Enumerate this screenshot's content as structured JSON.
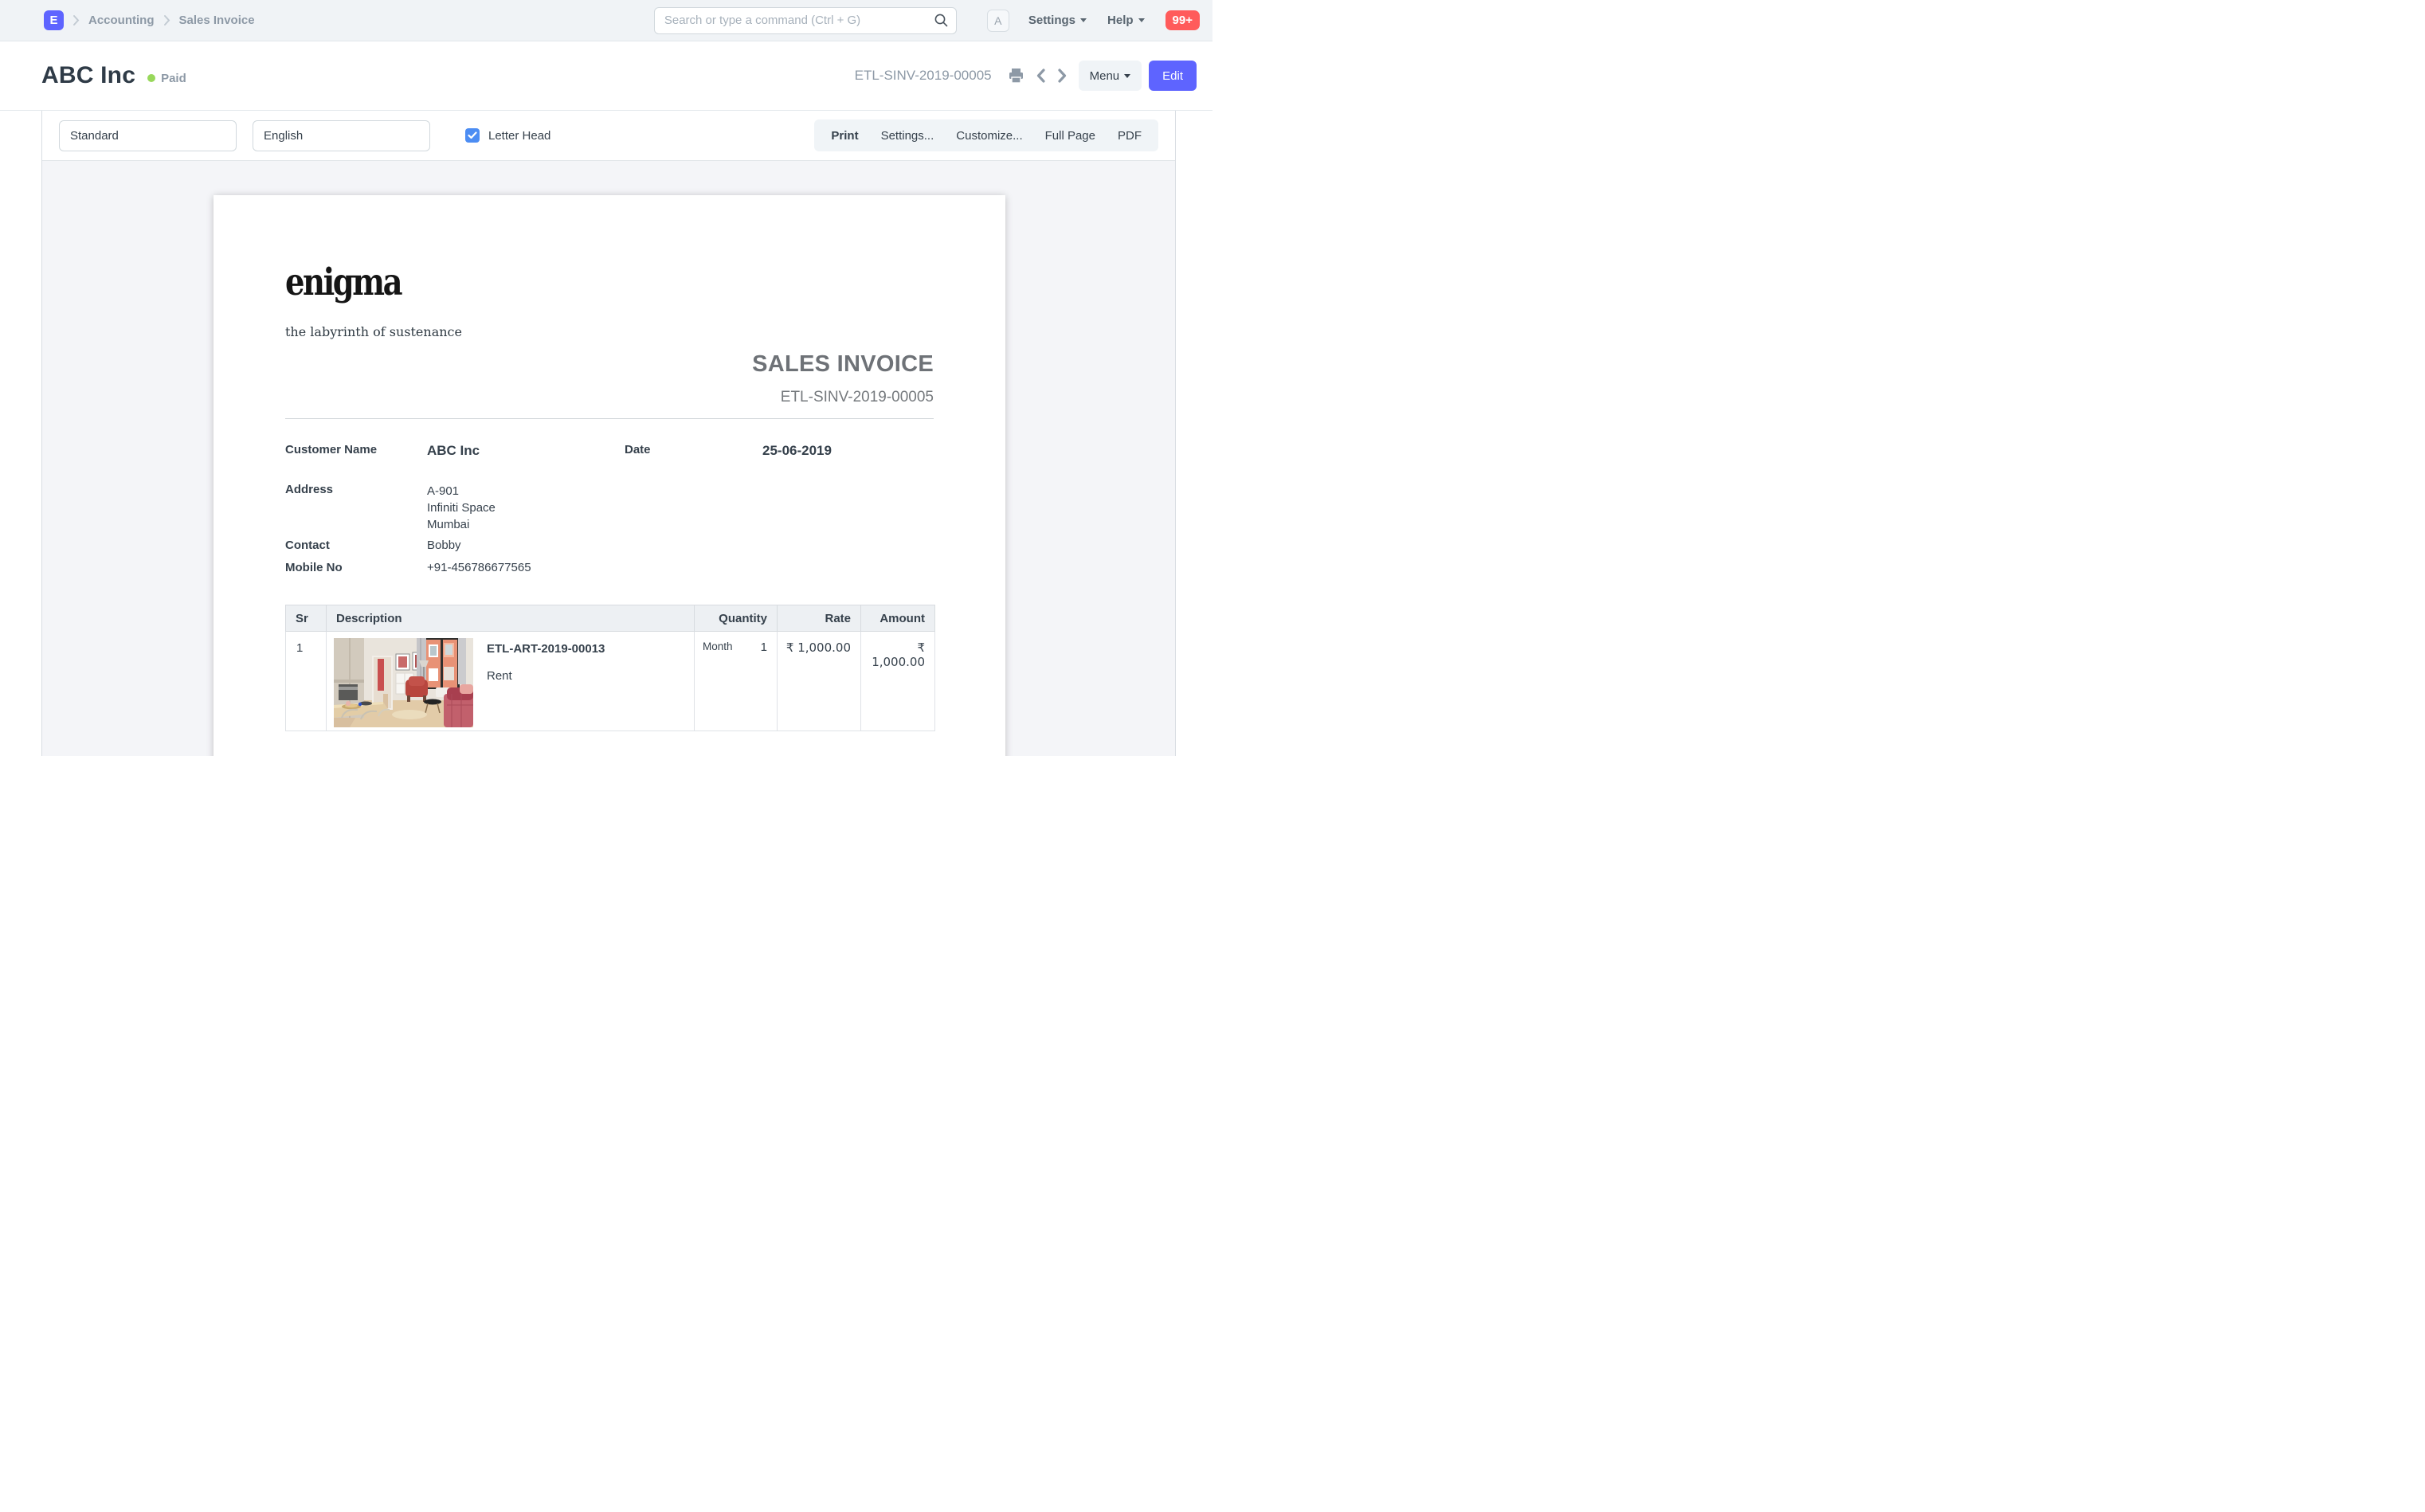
{
  "colors": {
    "accent": "#5e64ff",
    "status_paid": "#98d85b",
    "badge_red": "#ff5b5b",
    "checkbox_blue": "#4c8df3"
  },
  "navbar": {
    "logo_letter": "E",
    "breadcrumbs": [
      "Accounting",
      "Sales Invoice"
    ],
    "search_placeholder": "Search or type a command (Ctrl + G)",
    "avatar_letter": "A",
    "settings_label": "Settings",
    "help_label": "Help",
    "notifications_badge": "99+"
  },
  "page_header": {
    "title": "ABC Inc",
    "status": "Paid",
    "doc_id": "ETL-SINV-2019-00005",
    "menu_label": "Menu",
    "edit_label": "Edit"
  },
  "print_toolbar": {
    "format_select": "Standard",
    "language_select": "English",
    "letterhead_label": "Letter Head",
    "letterhead_checked": true,
    "actions": [
      "Print",
      "Settings...",
      "Customize...",
      "Full Page",
      "PDF"
    ]
  },
  "invoice": {
    "logo_text": "enigma",
    "logo_tagline": "the labyrinth of sustenance",
    "title": "SALES INVOICE",
    "number": "ETL-SINV-2019-00005",
    "details": {
      "customer_name_label": "Customer Name",
      "customer_name": "ABC Inc",
      "date_label": "Date",
      "date": "25-06-2019",
      "address_label": "Address",
      "address_lines": [
        "A-901",
        "Infiniti Space",
        "Mumbai"
      ],
      "contact_label": "Contact",
      "contact": "Bobby",
      "mobile_label": "Mobile No",
      "mobile": "+91-456786677565"
    },
    "items_table": {
      "headers": [
        "Sr",
        "Description",
        "Quantity",
        "Rate",
        "Amount"
      ],
      "rows": [
        {
          "sr": "1",
          "item_code": "ETL-ART-2019-00013",
          "item_name": "Rent",
          "uom": "Month",
          "qty": "1",
          "rate": "₹ 1,000.00",
          "amount": "₹ 1,000.00"
        }
      ]
    }
  }
}
